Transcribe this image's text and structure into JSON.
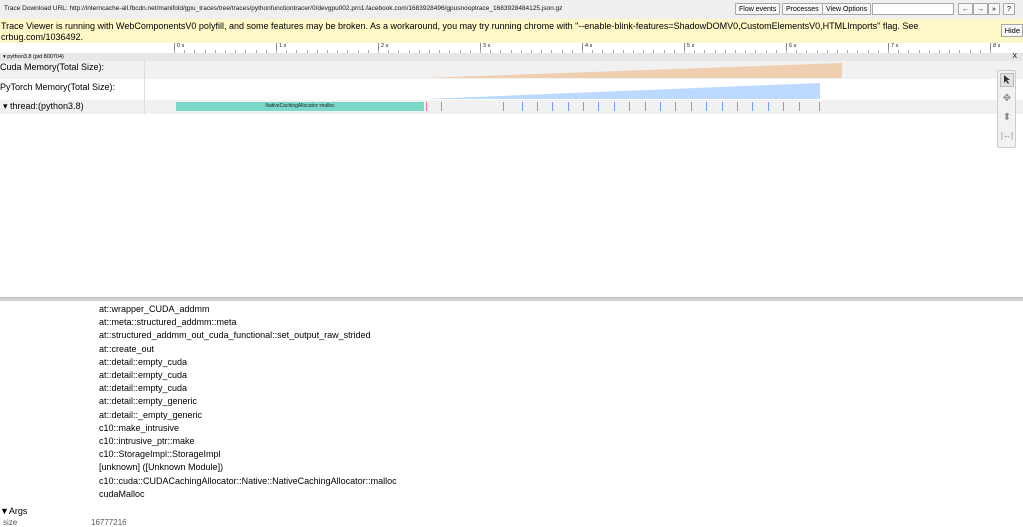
{
  "topbar": {
    "url_text": "Trace Download URL: http://interncache-all.fbcdn.net/manifold/gpu_traces/tree/traces/pythonfunctiontracer/0/devgpu002.prn1.facebook.com/1683928496/gpusnooptrace_1683928484125.json.gz",
    "buttons": [
      "Flow events",
      "Processes",
      "View Options"
    ],
    "search_placeholder": "",
    "nav": [
      "←",
      "→",
      "»",
      "?"
    ]
  },
  "warning": {
    "message": "Trace Viewer is running with WebComponentsV0 polyfill, and some features may be broken. As a workaround, you may try running chrome with \"--enable-blink-features=ShadowDOMV0,CustomElementsV0,HTMLImports\" flag. See crbug.com/1036492.",
    "hide_label": "Hide"
  },
  "ruler": {
    "ticks": [
      "0 s",
      "1 s",
      "2 s",
      "3 s",
      "4 s",
      "5 s",
      "6 s",
      "7 s",
      "8 s"
    ]
  },
  "process": {
    "label": "▾ python3.8 (pid 800704)",
    "close": "X"
  },
  "tracks": [
    {
      "label": "Cuda Memory(Total Size):",
      "color": "#f0cfb0"
    },
    {
      "label": "PyTorch Memory(Total Size):",
      "color": "#bcd9ff"
    },
    {
      "label": "▾  thread:(python3.8)",
      "slice_label": "NativeCachingAllocator::malloc",
      "slice_color": "#7ad8c8",
      "tick_color": "#6fa0ff"
    }
  ],
  "tools": [
    "select-arrow",
    "pan",
    "zoom",
    "timing"
  ],
  "stack_frames": [
    "at::wrapper_CUDA_addmm",
    "at::meta::structured_addmm::meta",
    "at::structured_addmm_out_cuda_functional::set_output_raw_strided",
    "at::create_out",
    "at::detail::empty_cuda",
    "at::detail::empty_cuda",
    "at::detail::empty_cuda",
    "at::detail::empty_generic",
    "at::detail::_empty_generic",
    "c10::make_intrusive",
    "c10::intrusive_ptr::make",
    "c10::StorageImpl::StorageImpl",
    "[unknown] ([Unknown Module])",
    "c10::cuda::CUDACachingAllocator::Native::NativeCachingAllocator::malloc",
    "cudaMalloc"
  ],
  "args": {
    "header": "▼Args",
    "first_row": {
      "key": "size",
      "value": "16777216"
    }
  }
}
